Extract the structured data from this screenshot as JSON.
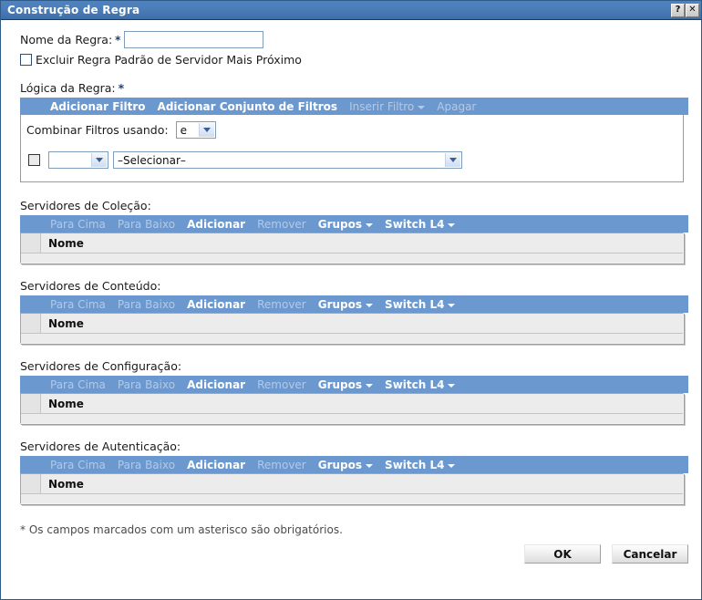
{
  "window": {
    "title": "Construção de Regra",
    "help_button": "?",
    "close_button": "✕"
  },
  "form": {
    "rule_name_label": "Nome da Regra:",
    "rule_name_required": "*",
    "rule_name_value": "",
    "rule_name_placeholder": "",
    "exclude_checkbox_label": "Excluir Regra Padrão de Servidor Mais Próximo",
    "exclude_checkbox_checked": false,
    "rule_logic_label": "Lógica da Regra:",
    "rule_logic_required": "*"
  },
  "logic_toolbar": {
    "items": [
      {
        "label": "Adicionar Filtro",
        "state": "enabled",
        "caret": false
      },
      {
        "label": "Adicionar Conjunto de Filtros",
        "state": "enabled",
        "caret": false
      },
      {
        "label": "Inserir Filtro",
        "state": "disabled",
        "caret": true
      },
      {
        "label": "Apagar",
        "state": "disabled",
        "caret": false
      }
    ]
  },
  "logic_panel": {
    "combine_label": "Combinar Filtros usando:",
    "combine_value": "e",
    "filter_row": {
      "checkbox_checked": false,
      "operator_value": "",
      "condition_value": "–Selecionar–"
    }
  },
  "server_sections": [
    {
      "label": "Servidores de Coleção:",
      "toolbar": [
        {
          "label": "Para Cima",
          "state": "disabled",
          "caret": false
        },
        {
          "label": "Para Baixo",
          "state": "disabled",
          "caret": false
        },
        {
          "label": "Adicionar",
          "state": "enabled",
          "caret": false
        },
        {
          "label": "Remover",
          "state": "disabled",
          "caret": false
        },
        {
          "label": "Grupos",
          "state": "enabled",
          "caret": true
        },
        {
          "label": "Switch L4",
          "state": "enabled",
          "caret": true
        }
      ],
      "column_header": "Nome",
      "rows": []
    },
    {
      "label": "Servidores de Conteúdo:",
      "toolbar": [
        {
          "label": "Para Cima",
          "state": "disabled",
          "caret": false
        },
        {
          "label": "Para Baixo",
          "state": "disabled",
          "caret": false
        },
        {
          "label": "Adicionar",
          "state": "enabled",
          "caret": false
        },
        {
          "label": "Remover",
          "state": "disabled",
          "caret": false
        },
        {
          "label": "Grupos",
          "state": "enabled",
          "caret": true
        },
        {
          "label": "Switch L4",
          "state": "enabled",
          "caret": true
        }
      ],
      "column_header": "Nome",
      "rows": []
    },
    {
      "label": "Servidores de Configuração:",
      "toolbar": [
        {
          "label": "Para Cima",
          "state": "disabled",
          "caret": false
        },
        {
          "label": "Para Baixo",
          "state": "disabled",
          "caret": false
        },
        {
          "label": "Adicionar",
          "state": "enabled",
          "caret": false
        },
        {
          "label": "Remover",
          "state": "disabled",
          "caret": false
        },
        {
          "label": "Grupos",
          "state": "enabled",
          "caret": true
        },
        {
          "label": "Switch L4",
          "state": "enabled",
          "caret": true
        }
      ],
      "column_header": "Nome",
      "rows": []
    },
    {
      "label": "Servidores de Autenticação:",
      "toolbar": [
        {
          "label": "Para Cima",
          "state": "disabled",
          "caret": false
        },
        {
          "label": "Para Baixo",
          "state": "disabled",
          "caret": false
        },
        {
          "label": "Adicionar",
          "state": "enabled",
          "caret": false
        },
        {
          "label": "Remover",
          "state": "disabled",
          "caret": false
        },
        {
          "label": "Grupos",
          "state": "enabled",
          "caret": true
        },
        {
          "label": "Switch L4",
          "state": "enabled",
          "caret": true
        }
      ],
      "column_header": "Nome",
      "rows": []
    }
  ],
  "footer": {
    "required_note_star": "*",
    "required_note": "Os campos marcados com um asterisco são obrigatórios.",
    "ok_label": "OK",
    "cancel_label": "Cancelar"
  },
  "colors": {
    "title_bar": "#4a7cb8",
    "toolbar_blue": "#6c98d0",
    "toolbar_disabled_text": "#b4c9e6",
    "toolbar_enabled_text": "#ffffff",
    "table_gray": "#ececec",
    "required_marker": "#1f3f6e"
  }
}
